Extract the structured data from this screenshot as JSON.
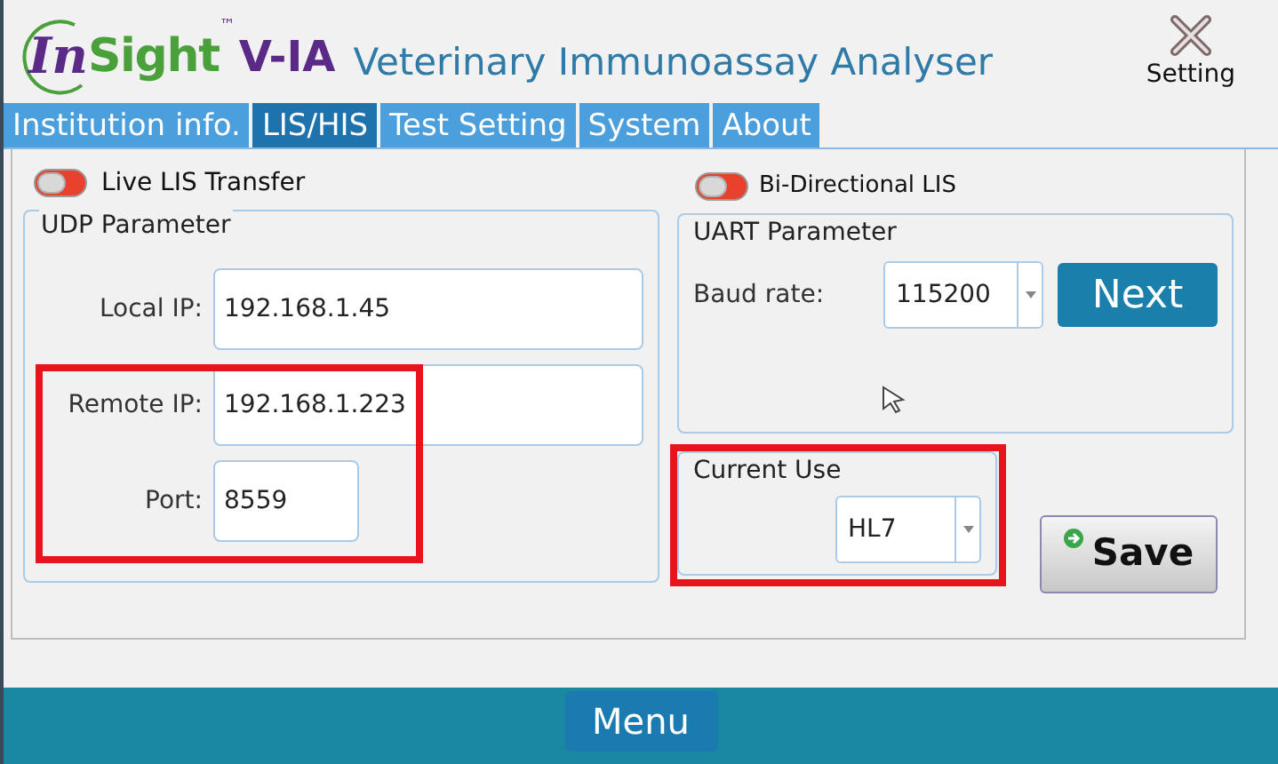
{
  "header": {
    "logo": {
      "prefix": "In",
      "name": "Sight",
      "tm": "™",
      "model": "V-IA"
    },
    "title": "Veterinary Immunoassay Analyser",
    "setting_button": "Setting"
  },
  "tabs": [
    {
      "label": "Institution info.",
      "selected": false
    },
    {
      "label": "LIS/HIS",
      "selected": true
    },
    {
      "label": "Test Setting",
      "selected": false
    },
    {
      "label": "System",
      "selected": false
    },
    {
      "label": "About",
      "selected": false
    }
  ],
  "live_lis_transfer": {
    "label": "Live LIS Transfer",
    "on": false
  },
  "udp_parameter": {
    "title": "UDP Parameter",
    "fields": [
      {
        "label": "Local IP:",
        "value": "192.168.1.45",
        "kind": "wide"
      },
      {
        "label": "Remote IP:",
        "value": "192.168.1.223",
        "kind": "wide"
      },
      {
        "label": "Port:",
        "value": "8559",
        "kind": "short"
      }
    ]
  },
  "bi_directional_lis": {
    "label": "Bi-Directional LIS",
    "on": false
  },
  "uart_parameter": {
    "title": "UART Parameter",
    "baud_rate_label": "Baud rate:",
    "baud_rate": "115200",
    "next_button": "Next"
  },
  "current_use": {
    "title": "Current Use",
    "value": "HL7"
  },
  "save_button": "Save",
  "menu_button": "Menu"
}
